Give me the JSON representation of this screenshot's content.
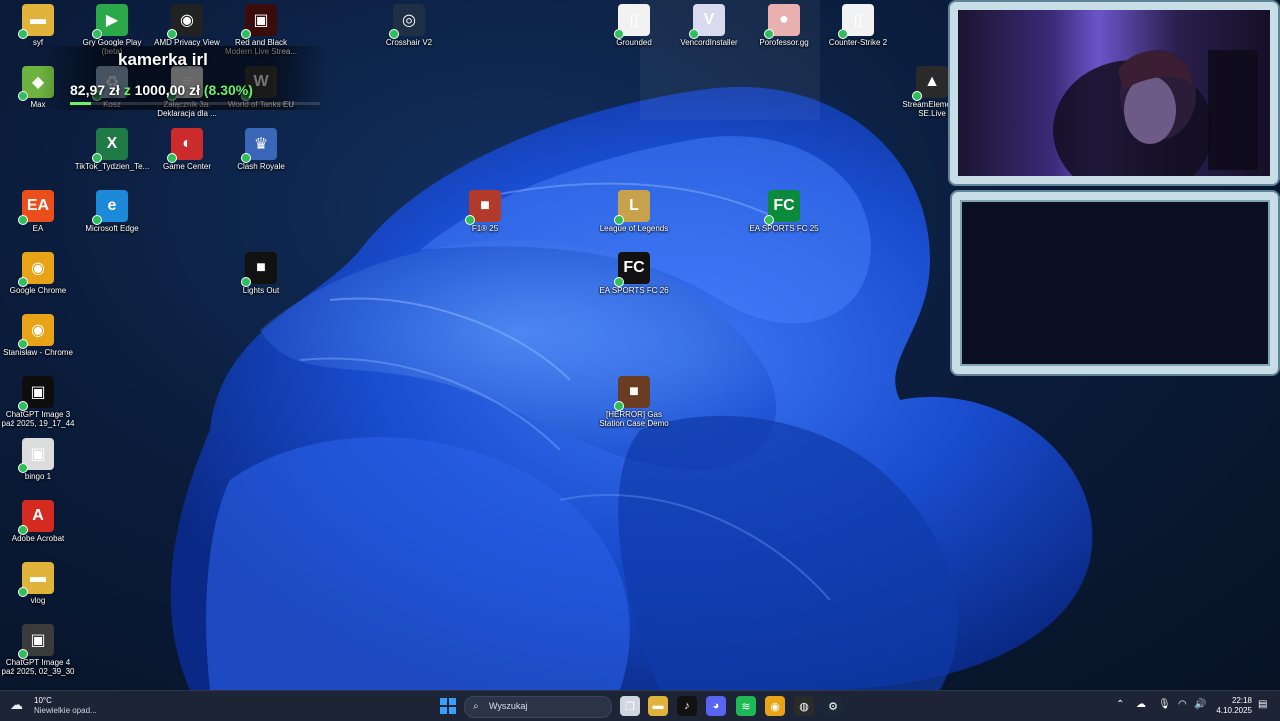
{
  "desktop_icons": [
    {
      "label": "syf",
      "icon": "folder-icon",
      "color": "#e2b33a"
    },
    {
      "label": "Gry Google Play (beta)",
      "icon": "google-play-games-icon",
      "color": "#2aa84a"
    },
    {
      "label": "AMD Privacy View",
      "icon": "eye-icon",
      "color": "#222222"
    },
    {
      "label": "Red and Black Modern Live Strea...",
      "icon": "image-thumbnail-icon",
      "color": "#3a0c0c"
    },
    {
      "label": "Crosshair V2",
      "icon": "crosshair-icon",
      "color": "#1f2f45"
    },
    {
      "label": "Grounded",
      "icon": "file-icon",
      "color": "#f2f2f2"
    },
    {
      "label": "VencordInstaller",
      "icon": "vencord-icon",
      "color": "#d9d9ef"
    },
    {
      "label": "Porofessor.gg",
      "icon": "porofessor-icon",
      "color": "#e9b0b0"
    },
    {
      "label": "Counter-Strike 2",
      "icon": "file-icon",
      "color": "#f2f2f2"
    },
    {
      "label": "Max",
      "icon": "app-icon",
      "color": "#6db33f"
    },
    {
      "label": "Kosz",
      "icon": "recycle-bin-icon",
      "color": "#9ab8d6"
    },
    {
      "label": "Załącznik 3a. Deklaracja dla ...",
      "icon": "document-icon",
      "color": "#e6e6e6"
    },
    {
      "label": "World of Tanks EU",
      "icon": "world-of-tanks-icon",
      "color": "#3a3a3a"
    },
    {
      "label": "StreamElements SE.Live",
      "icon": "rocket-icon",
      "color": "#2a2a2a"
    },
    {
      "label": "TikTok_Tydzien_Te...",
      "icon": "excel-icon",
      "color": "#1f7a45"
    },
    {
      "label": "Game Center",
      "icon": "game-center-icon",
      "color": "#cc2b2b"
    },
    {
      "label": "Clash Royale",
      "icon": "clash-royale-icon",
      "color": "#3a66b8"
    },
    {
      "label": "EA",
      "icon": "ea-icon",
      "color": "#e94e1b"
    },
    {
      "label": "Microsoft Edge",
      "icon": "edge-icon",
      "color": "#1c8ad8"
    },
    {
      "label": "F1® 25",
      "icon": "game-thumbnail-icon",
      "color": "#b23a2a"
    },
    {
      "label": "League of Legends",
      "icon": "league-of-legends-icon",
      "color": "#c8a24a"
    },
    {
      "label": "EA SPORTS FC 25",
      "icon": "fc25-icon",
      "color": "#0a8a3a"
    },
    {
      "label": "Google Chrome",
      "icon": "chrome-icon",
      "color": "#e8a317"
    },
    {
      "label": "Lights Out",
      "icon": "game-thumbnail-icon",
      "color": "#111111"
    },
    {
      "label": "EA SPORTS FC 26",
      "icon": "fc26-icon",
      "color": "#111111"
    },
    {
      "label": "Stanisław - Chrome",
      "icon": "chrome-profile-icon",
      "color": "#e8a317"
    },
    {
      "label": "ChatGPT Image 3 paź 2025, 19_17_44",
      "icon": "image-thumbnail-icon",
      "color": "#0d0d0d"
    },
    {
      "label": "[HERROR] Gas Station Case Demo",
      "icon": "game-thumbnail-icon",
      "color": "#6a3d22"
    },
    {
      "label": "bingo 1",
      "icon": "image-thumbnail-icon",
      "color": "#dcdcdc"
    },
    {
      "label": "Adobe Acrobat",
      "icon": "acrobat-icon",
      "color": "#d42a20"
    },
    {
      "label": "vlog",
      "icon": "folder-icon",
      "color": "#e2b33a"
    },
    {
      "label": "ChatGPT Image 4 paź 2025, 02_39_30",
      "icon": "image-thumbnail-icon",
      "color": "#3b3b3b"
    }
  ],
  "overlay": {
    "title": "kamerka irl",
    "amount_current": "82,97 zł",
    "amount_separator": "z",
    "amount_goal": "1000,00 zł",
    "percent_text": "(8.30%)",
    "progress_fraction": 0.083,
    "accent_color": "#6cf06a"
  },
  "taskbar": {
    "weather_temp": "10°C",
    "weather_desc": "Niewielkie opad...",
    "search_placeholder": "Wyszukaj",
    "clock_time": "22:18",
    "clock_date": "4.10.2025",
    "apps": [
      {
        "name": "start",
        "icon": "windows-start-icon",
        "color": "#2e8fe8"
      },
      {
        "name": "task-view",
        "icon": "task-view-icon",
        "color": "#cfd6e2"
      },
      {
        "name": "file-explorer",
        "icon": "folder-icon",
        "color": "#e2b33a"
      },
      {
        "name": "tiktok",
        "icon": "tiktok-icon",
        "color": "#111111"
      },
      {
        "name": "discord",
        "icon": "discord-icon",
        "color": "#5865f2"
      },
      {
        "name": "spotify",
        "icon": "spotify-icon",
        "color": "#1db954"
      },
      {
        "name": "chrome",
        "icon": "chrome-icon",
        "color": "#e8a317"
      },
      {
        "name": "obs",
        "icon": "obs-icon",
        "color": "#2b2b2b"
      },
      {
        "name": "steam",
        "icon": "steam-icon",
        "color": "#1b2838"
      }
    ]
  }
}
